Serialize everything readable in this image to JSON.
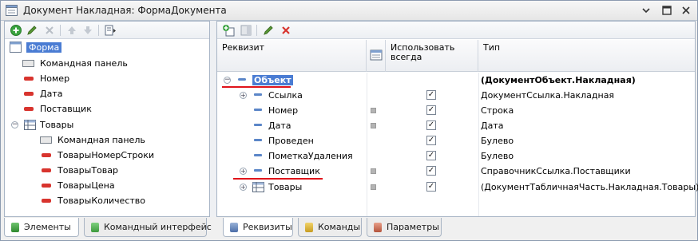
{
  "window": {
    "title": "Документ Накладная: ФормаДокумента"
  },
  "left_tree": {
    "items": [
      {
        "label": "Форма",
        "icon": "form-icon"
      },
      {
        "label": "Командная панель",
        "icon": "command-panel-icon"
      },
      {
        "label": "Номер",
        "icon": "attribute-icon"
      },
      {
        "label": "Дата",
        "icon": "attribute-icon"
      },
      {
        "label": "Поставщик",
        "icon": "attribute-icon"
      },
      {
        "label": "Товары",
        "icon": "table-icon"
      },
      {
        "label": "Командная панель",
        "icon": "command-panel-icon"
      },
      {
        "label": "ТоварыНомерСтроки",
        "icon": "attribute-icon"
      },
      {
        "label": "ТоварыТовар",
        "icon": "attribute-icon"
      },
      {
        "label": "ТоварыЦена",
        "icon": "attribute-icon"
      },
      {
        "label": "ТоварыКоличество",
        "icon": "attribute-icon"
      }
    ]
  },
  "grid": {
    "headers": {
      "requisite": "Реквизит",
      "use_always": "Использовать всегда",
      "type": "Тип"
    },
    "rows": [
      {
        "name": "Объект",
        "type": "(ДокументОбъект.Накладная)",
        "checked": false,
        "square": false
      },
      {
        "name": "Ссылка",
        "type": "ДокументСсылка.Накладная",
        "checked": true,
        "square": false
      },
      {
        "name": "Номер",
        "type": "Строка",
        "checked": true,
        "square": true
      },
      {
        "name": "Дата",
        "type": "Дата",
        "checked": true,
        "square": true
      },
      {
        "name": "Проведен",
        "type": "Булево",
        "checked": true,
        "square": false
      },
      {
        "name": "ПометкаУдаления",
        "type": "Булево",
        "checked": true,
        "square": false
      },
      {
        "name": "Поставщик",
        "type": "СправочникСсылка.Поставщики",
        "checked": true,
        "square": true
      },
      {
        "name": "Товары",
        "type": "(ДокументТабличнаяЧасть.Накладная.Товары)",
        "checked": true,
        "square": true
      }
    ]
  },
  "tabs": {
    "left": [
      "Элементы",
      "Командный интерфейс"
    ],
    "right": [
      "Реквизиты",
      "Команды",
      "Параметры"
    ]
  },
  "colors": {
    "selection": "#4a7cd3",
    "red_underline": "#e0141b",
    "attribute_red": "#d8342e"
  }
}
